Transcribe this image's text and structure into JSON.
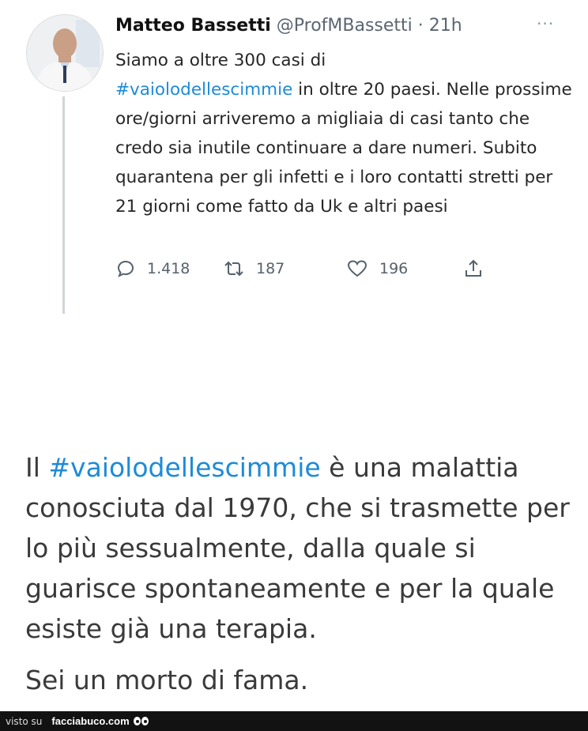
{
  "tweet": {
    "author_name": "Matteo Bassetti",
    "handle": "@ProfMBassetti",
    "separator": " · ",
    "time": "21h",
    "more_icon": "more-icon",
    "text": {
      "line1": "Siamo a oltre 300 casi di",
      "hashtag": "#vaiolodellescimmie",
      "after_hashtag": " in oltre 20 paesi. Nelle prossime ore/giorni arriveremo a migliaia di casi tanto che credo sia inutile continuare a dare numeri. Subito quarantena per gli infetti e i loro contatti stretti per 21 giorni come fatto da Uk e altri paesi"
    },
    "actions": {
      "replies": "1.418",
      "retweets": "187",
      "likes": "196"
    }
  },
  "reply_text": {
    "prefix": "Il ",
    "hashtag": "#vaiolodellescimmie",
    "body": " è una malattia conosciuta dal 1970, che si trasmette per lo più sessualmente, dalla quale si guarisce spontaneamente e per la quale esiste già una terapia.",
    "closing": "Sei un morto di fama."
  },
  "footer": {
    "visto_su": "visto su",
    "brand": "facciabuco.com"
  },
  "colors": {
    "hashtag": "#1d8bd8",
    "muted": "#5b6671",
    "footer_bg": "#121212"
  }
}
